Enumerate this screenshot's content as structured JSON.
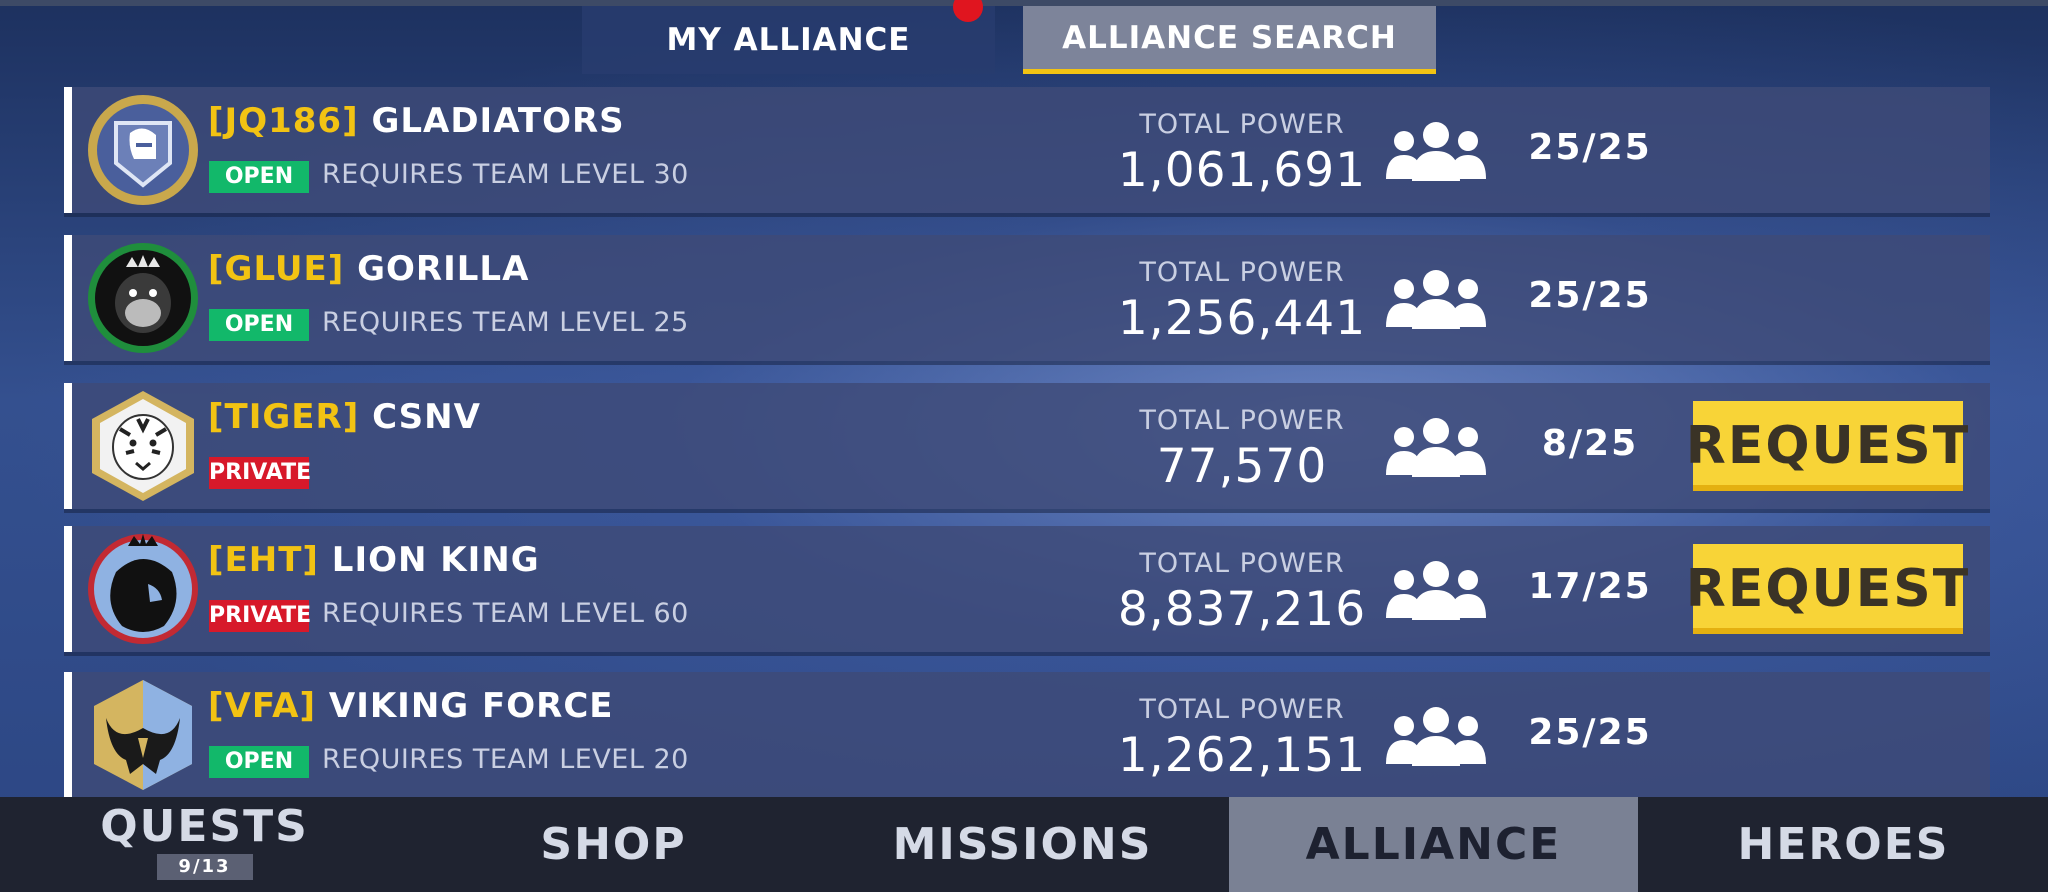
{
  "colors": {
    "tag_gold": "#f2c313",
    "open_green": "#12b86a",
    "private_red": "#d7192a",
    "request_yellow": "#f8d437",
    "active_tab_underline": "#f2c313"
  },
  "top_tabs": [
    {
      "label": "MY ALLIANCE",
      "active": false
    },
    {
      "label": "ALLIANCE SEARCH",
      "active": true
    }
  ],
  "alliances": [
    {
      "tag": "[JQ186]",
      "name": "GLADIATORS",
      "status": "OPEN",
      "requirement": "REQUIRES TEAM LEVEL 30",
      "power_label": "TOTAL POWER",
      "power": "1,061,691",
      "members": "25/25",
      "request_label": "",
      "emblem": "knight-helmet-icon"
    },
    {
      "tag": "[GLUE]",
      "name": "GORILLA",
      "status": "OPEN",
      "requirement": "REQUIRES TEAM LEVEL 25",
      "power_label": "TOTAL POWER",
      "power": "1,256,441",
      "members": "25/25",
      "request_label": "",
      "emblem": "gorilla-icon"
    },
    {
      "tag": "[TIGER]",
      "name": "CSNV",
      "status": "PRIVATE",
      "requirement": "",
      "power_label": "TOTAL POWER",
      "power": "77,570",
      "members": "8/25",
      "request_label": "REQUEST",
      "emblem": "tiger-icon"
    },
    {
      "tag": "[EHT]",
      "name": "LION KING",
      "status": "PRIVATE",
      "requirement": "REQUIRES TEAM LEVEL 60",
      "power_label": "TOTAL POWER",
      "power": "8,837,216",
      "members": "17/25",
      "request_label": "REQUEST",
      "emblem": "lion-icon"
    },
    {
      "tag": "[VFA]",
      "name": "VIKING FORCE",
      "status": "OPEN",
      "requirement": "REQUIRES TEAM LEVEL 20",
      "power_label": "TOTAL POWER",
      "power": "1,262,151",
      "members": "25/25",
      "request_label": "",
      "emblem": "viking-helmet-icon"
    }
  ],
  "bottom_nav": {
    "quests": {
      "label": "QUESTS",
      "counter": "9/13"
    },
    "shop": "SHOP",
    "missions": "MISSIONS",
    "alliance": "ALLIANCE",
    "heroes": "HEROES",
    "active": "alliance"
  }
}
